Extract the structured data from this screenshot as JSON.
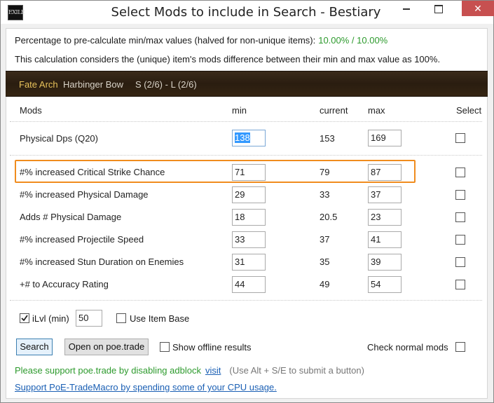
{
  "window": {
    "title": "Select Mods to include in Search - Bestiary",
    "icon_text": "EXILE",
    "close_glyph": "✕"
  },
  "info": {
    "precalc_label": "Percentage to pre-calculate min/max values (halved for non-unique items):",
    "precalc_value": "10.00% / 10.00%",
    "calc_note": "This calculation considers the (unique) item's mods difference between their min and max value as 100%."
  },
  "item": {
    "name": "Fate Arch",
    "base": "Harbinger Bow",
    "sockets": "S (2/6) - L (2/6)"
  },
  "columns": {
    "mods": "Mods",
    "min": "min",
    "current": "current",
    "max": "max",
    "select": "Select"
  },
  "rows": [
    {
      "label": "Physical Dps (Q20)",
      "min": "138",
      "current": "153",
      "max": "169"
    },
    {
      "label": "#% increased Critical Strike Chance",
      "min": "71",
      "current": "79",
      "max": "87"
    },
    {
      "label": "#% increased Physical Damage",
      "min": "29",
      "current": "33",
      "max": "37"
    },
    {
      "label": "Adds # Physical Damage",
      "min": "18",
      "current": "20.5",
      "max": "23"
    },
    {
      "label": "#% increased Projectile Speed",
      "min": "33",
      "current": "37",
      "max": "41"
    },
    {
      "label": "#% increased Stun Duration on Enemies",
      "min": "31",
      "current": "35",
      "max": "39"
    },
    {
      "label": "+# to Accuracy Rating",
      "min": "44",
      "current": "49",
      "max": "54"
    }
  ],
  "options": {
    "ilvl_label": "iLvl (min)",
    "ilvl_value": "50",
    "ilvl_checked": true,
    "use_item_base_label": "Use Item Base",
    "show_offline_label": "Show offline results",
    "check_normal_mods_label": "Check normal mods"
  },
  "buttons": {
    "search": "Search",
    "open_on_poe_trade": "Open on poe.trade"
  },
  "footer": {
    "support_text": "Please support poe.trade by disabling adblock",
    "visit_link": "visit",
    "hint": "(Use Alt + S/E to submit a button)",
    "support_macro": "Support PoE-TradeMacro by spending some of your CPU usage."
  },
  "colors": {
    "accent_green": "#2d9a2d",
    "highlight_orange": "#f08c1e",
    "link_blue": "#1a5fb4",
    "item_name_gold": "#e8c25a"
  }
}
